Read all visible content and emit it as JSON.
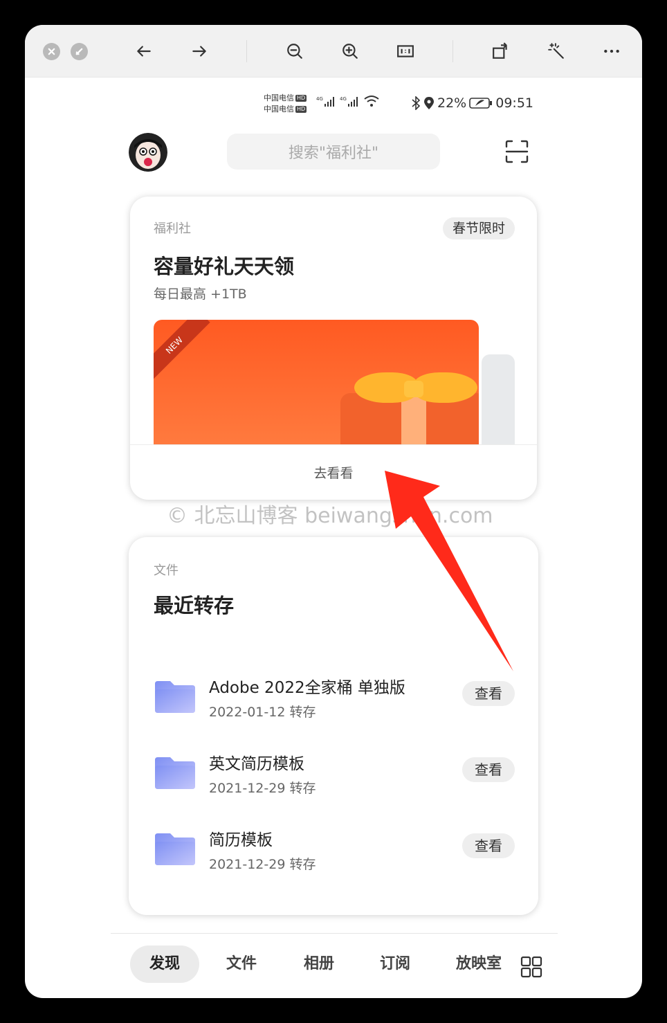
{
  "toolbar": {
    "buttons": [
      "close-icon",
      "minimize-icon",
      "back-icon",
      "forward-icon",
      "zoom-out-icon",
      "zoom-in-icon",
      "actual-size-icon",
      "rotate-icon",
      "magic-wand-icon",
      "more-icon"
    ]
  },
  "status_bar": {
    "carrier1": "中国电信",
    "carrier2": "中国电信",
    "hd": "HD",
    "network": "4G",
    "battery": "22%",
    "time": "09:51"
  },
  "header": {
    "search_placeholder": "搜索\"福利社\""
  },
  "welfare_card": {
    "category": "福利社",
    "badge": "春节限时",
    "title": "容量好礼天天领",
    "subtitle": "每日最高 +1TB",
    "ribbon": "NEW",
    "action": "去看看"
  },
  "watermark": "© 北忘山博客 beiwangshan.com",
  "files_card": {
    "category": "文件",
    "title": "最近转存",
    "items": [
      {
        "name": "Adobe 2022全家桶 单独版",
        "date": "2022-01-12 转存",
        "action": "查看"
      },
      {
        "name": "英文简历模板",
        "date": "2021-12-29 转存",
        "action": "查看"
      },
      {
        "name": "简历模板",
        "date": "2021-12-29 转存",
        "action": "查看"
      }
    ]
  },
  "bottom_nav": {
    "tabs": [
      "发现",
      "文件",
      "相册",
      "订阅",
      "放映室"
    ],
    "active": "发现"
  },
  "colors": {
    "banner": "#ff5a22",
    "bow": "#ffb52e",
    "folder": "#8f9cf5",
    "arrow": "#ff2a1a"
  }
}
